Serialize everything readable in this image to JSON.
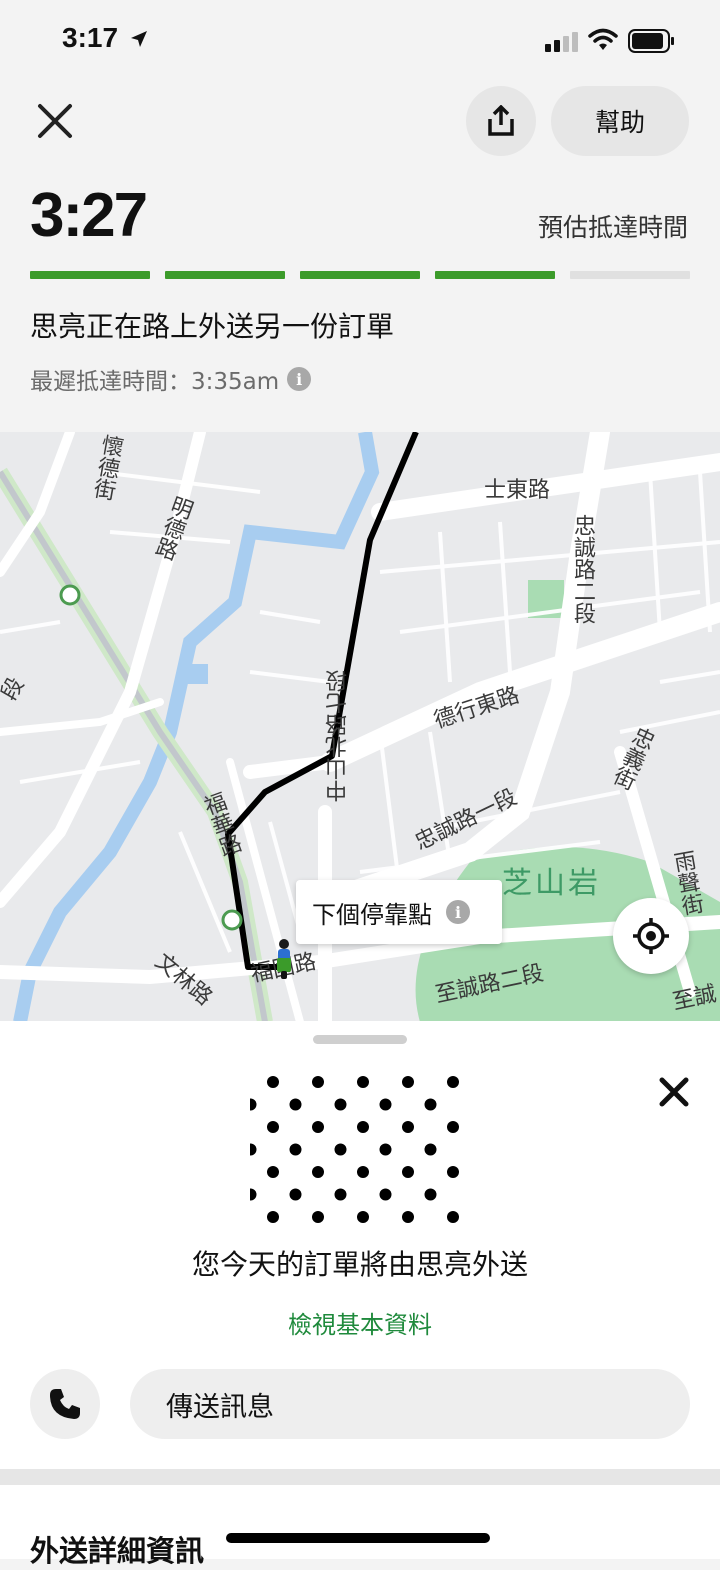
{
  "status_bar": {
    "time": "3:17"
  },
  "header": {
    "help_label": "幫助",
    "eta_time": "3:27",
    "eta_label": "預估抵達時間",
    "progress_completed": 4,
    "progress_total": 5,
    "status_message": "思亮正在路上外送另一份訂單",
    "latest_arrival": "最遲抵達時間：3:35am"
  },
  "map": {
    "labels": {
      "road_shidong": "士東路",
      "road_zhongcheng2": "忠誠路二段",
      "road_mingde": "明德路",
      "road_huaide": "懷德街",
      "road_dexingdong": "德行東路",
      "road_zhongshan": "中山北路七段",
      "road_zhongyi": "忠義街",
      "road_zhongcheng1": "忠誠路一段",
      "area_zhishanyan": "芝山岩",
      "road_yusheng": "雨聲街",
      "road_fuhua": "福華路",
      "road_wenlin": "文林路",
      "road_fuguo": "福國路",
      "road_zhicheng2": "至誠路二段",
      "road_zhicheng": "至誠",
      "road_edge": "段"
    },
    "next_stop_label": "下個停靠點"
  },
  "sheet": {
    "courier_message": "您今天的訂單將由思亮外送",
    "view_profile_label": "檢視基本資料",
    "message_placeholder": "傳送訊息"
  },
  "details": {
    "title": "外送詳細資訊"
  },
  "colors": {
    "accent_green": "#3b9b2a",
    "link_green": "#1f8a3c",
    "progress_empty": "#e0e0e0",
    "park_green": "#a9dcb3",
    "river_blue": "#a8cdf0"
  },
  "icons": {
    "close": "close-icon",
    "share": "share-icon",
    "info": "info-icon",
    "locate": "crosshair-icon",
    "phone": "phone-icon",
    "courier": "scooter-icon"
  }
}
